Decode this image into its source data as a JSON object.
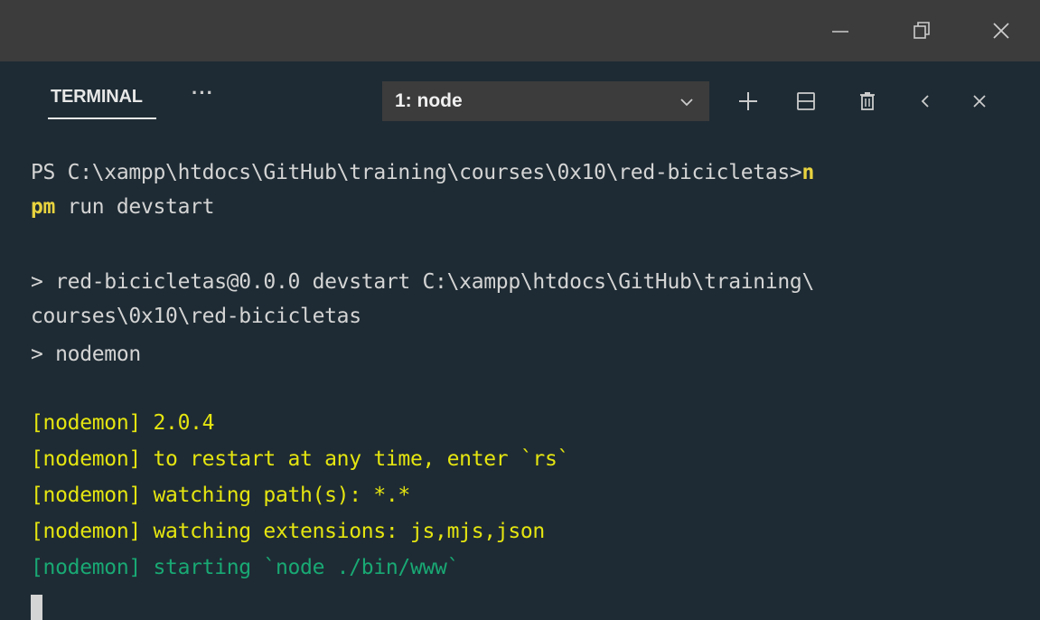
{
  "window_controls": {
    "minimize_icon": "minimize-icon",
    "restore_icon": "restore-icon",
    "close_icon": "close-icon"
  },
  "panel": {
    "tab_label": "TERMINAL",
    "more_label": "···",
    "terminal_select_value": "1: node",
    "actions": [
      "new-terminal",
      "split-terminal",
      "kill-terminal",
      "maximize-panel",
      "close-panel"
    ]
  },
  "terminal": {
    "line1_a": "PS C:\\xampp\\htdocs\\GitHub\\training\\courses\\0x10\\red-bicicletas>",
    "line1_b": "n",
    "line2_a": "pm",
    "line2_b": " run devstart",
    "line3": "> red-bicicletas@0.0.0 devstart C:\\xampp\\htdocs\\GitHub\\training\\",
    "line4": "courses\\0x10\\red-bicicletas",
    "line5": "> nodemon",
    "nodemon_lines": [
      "[nodemon] 2.0.4",
      "[nodemon] to restart at any time, enter `rs`",
      "[nodemon] watching path(s): *.*",
      "[nodemon] watching extensions: js,mjs,json",
      "[nodemon] starting `node ./bin/www`"
    ]
  },
  "colors": {
    "background": "#1e2b34",
    "titlebar": "#3c3c3c",
    "nodemon_yellow": "#e5e510",
    "nodemon_green": "#19a974",
    "command_highlight": "#e8d33f"
  }
}
